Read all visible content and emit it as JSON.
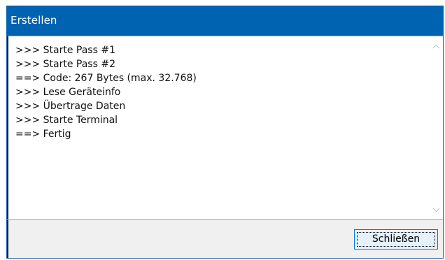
{
  "window": {
    "title": "Erstellen"
  },
  "log": {
    "lines": [
      ">>> Starte Pass #1",
      ">>> Starte Pass #2",
      "==> Code: 267 Bytes (max. 32.768)",
      ">>> Lese Geräteinfo",
      ">>> Übertrage Daten",
      ">>> Starte Terminal",
      "==> Fertig"
    ]
  },
  "scrollbar": {
    "up_icon": "chevron-up-icon",
    "down_icon": "chevron-down-icon"
  },
  "footer": {
    "close_label": "Schließen"
  },
  "colors": {
    "titlebar": "#0063b1",
    "title_text": "#ffffff",
    "button_bg": "#e5f1fb",
    "button_border": "#0078d7"
  }
}
